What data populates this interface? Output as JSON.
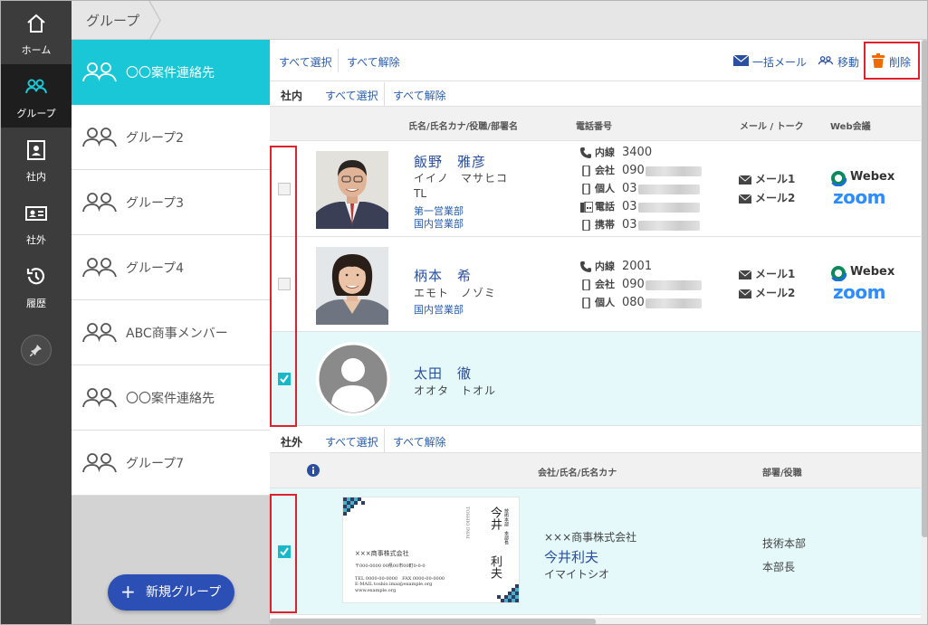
{
  "nav": {
    "items": [
      {
        "label": "ホーム",
        "icon": "home-icon"
      },
      {
        "label": "グループ",
        "icon": "group-icon"
      },
      {
        "label": "社内",
        "icon": "internal-contacts-icon"
      },
      {
        "label": "社外",
        "icon": "external-contacts-icon"
      },
      {
        "label": "履歴",
        "icon": "history-icon"
      }
    ],
    "active": "グループ"
  },
  "breadcrumb": {
    "label": "グループ"
  },
  "groups": {
    "items": [
      {
        "label": "〇〇案件連絡先",
        "active": true
      },
      {
        "label": "グループ2"
      },
      {
        "label": "グループ3"
      },
      {
        "label": "グループ4"
      },
      {
        "label": "ABC商事メンバー"
      },
      {
        "label": "〇〇案件連絡先"
      },
      {
        "label": "グループ7"
      }
    ],
    "new_button": "新規グループ"
  },
  "toolbar": {
    "select_all": "すべて選択",
    "deselect_all": "すべて解除",
    "bulk_mail": "一括メール",
    "move": "移動",
    "delete": "削除"
  },
  "internal": {
    "section_label": "社内",
    "select_all": "すべて選択",
    "deselect_all": "すべて解除",
    "columns": {
      "name": "氏名/氏名カナ/役職/部署名",
      "phone": "電話番号",
      "mail": "メール / トーク",
      "web": "Web会議"
    },
    "rows": [
      {
        "checked": false,
        "name": "飯野　雅彦",
        "kana": "イイノ　マサヒコ",
        "title": "TL",
        "depts": [
          "第一営業部",
          "国内営業部"
        ],
        "phones": [
          {
            "label": "内線",
            "value": "3400"
          },
          {
            "label": "会社",
            "value": "090"
          },
          {
            "label": "個人",
            "value": "03"
          },
          {
            "label": "電話",
            "value": "03"
          },
          {
            "label": "携帯",
            "value": "03"
          }
        ],
        "mails": [
          "メール1",
          "メール2"
        ],
        "web": {
          "webex": "Webex",
          "zoom": "zoom"
        }
      },
      {
        "checked": false,
        "name": "柄本　希",
        "kana": "エモト　ノゾミ",
        "depts": [
          "国内営業部"
        ],
        "phones": [
          {
            "label": "内線",
            "value": "2001"
          },
          {
            "label": "会社",
            "value": "090"
          },
          {
            "label": "個人",
            "value": "080"
          }
        ],
        "mails": [
          "メール1",
          "メール2"
        ],
        "web": {
          "webex": "Webex",
          "zoom": "zoom"
        }
      },
      {
        "checked": true,
        "name": "太田　徹",
        "kana": "オオタ　トオル"
      }
    ]
  },
  "external": {
    "section_label": "社外",
    "select_all": "すべて選択",
    "deselect_all": "すべて解除",
    "columns": {
      "company": "会社/氏名/氏名カナ",
      "dept": "部署/役職"
    },
    "rows": [
      {
        "checked": true,
        "company": "×××商事株式会社",
        "name": "今井利夫",
        "kana": "イマイトシオ",
        "dept": "技術本部",
        "role": "本部長",
        "card": {
          "company": "×××商事株式会社",
          "address": "〒000-0000 00県00市00町0-0-0",
          "tel": "TEL 0000-00-0000　FAX 0000-00-0000",
          "email": "E-MAIL toshio.imai@example.org",
          "url": "www.example.org",
          "name_top": "今井",
          "name_bottom": "利夫",
          "roman": "TOSHIO IMAI",
          "title": "技術本部　本部長"
        }
      }
    ]
  },
  "colors": {
    "accent": "#19c7d6",
    "nav_bg": "#3c3c3c",
    "link": "#2a5db0",
    "highlight": "#e0202a",
    "button": "#2c4fb5",
    "delete": "#f06a00"
  }
}
